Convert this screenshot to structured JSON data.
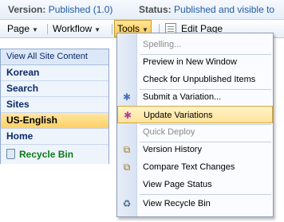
{
  "status_bar": {
    "version_label": "Version:",
    "version_value": "Published (1.0)",
    "status_label": "Status:",
    "status_value": "Published and visible to"
  },
  "toolbar": {
    "page_label": "Page",
    "workflow_label": "Workflow",
    "tools_label": "Tools",
    "edit_page_label": "Edit Page"
  },
  "quick_launch": {
    "view_all": "View All Site Content",
    "items": [
      "Korean",
      "Search",
      "Sites",
      "US-English",
      "Home"
    ],
    "selected": "US-English",
    "recycle_bin": "Recycle Bin"
  },
  "tools_menu": {
    "items": [
      {
        "label": "Spelling...",
        "disabled": true,
        "icon": ""
      },
      {
        "label": "Preview in New Window",
        "disabled": false,
        "icon": ""
      },
      {
        "label": "Check for Unpublished Items",
        "disabled": false,
        "icon": ""
      },
      {
        "label": "Submit a Variation...",
        "disabled": false,
        "icon": "variation-icon"
      },
      {
        "label": "Update Variations",
        "disabled": false,
        "icon": "update-variations-icon",
        "highlighted": true
      },
      {
        "label": "Quick Deploy",
        "disabled": true,
        "icon": ""
      },
      {
        "label": "Version History",
        "disabled": false,
        "icon": "version-history-icon"
      },
      {
        "label": "Compare Text Changes",
        "disabled": false,
        "icon": "compare-icon"
      },
      {
        "label": "View Page Status",
        "disabled": false,
        "icon": ""
      },
      {
        "label": "View Recycle Bin",
        "disabled": false,
        "icon": "recycle-bin-icon"
      }
    ]
  },
  "colors": {
    "highlight": "#ffe39a",
    "link_blue": "#1f5ca8",
    "recycle_green": "#0a7a1a"
  }
}
